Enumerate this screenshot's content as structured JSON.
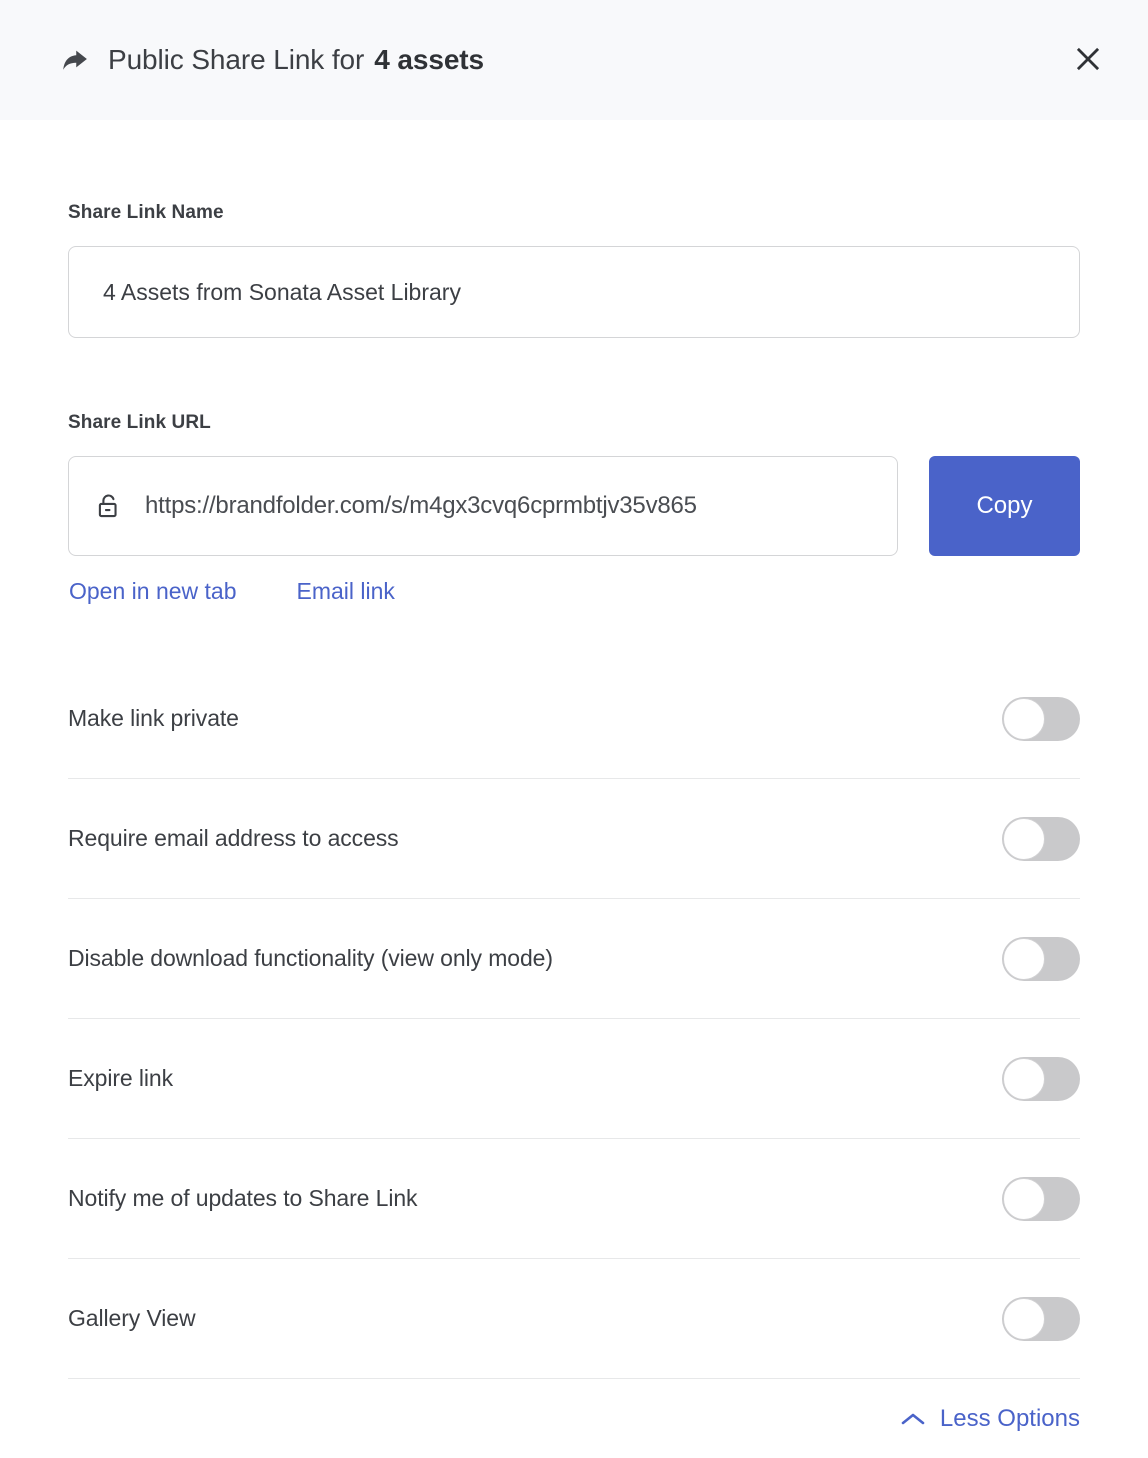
{
  "header": {
    "share_icon": "share-arrow-icon",
    "title_prefix": "Public Share Link for",
    "title_count": "4 assets",
    "close_icon": "close-icon"
  },
  "name_field": {
    "label": "Share Link Name",
    "value": "4 Assets from Sonata Asset Library",
    "placeholder": "Share Link Name"
  },
  "url_field": {
    "label": "Share Link URL",
    "lock_icon": "unlocked-padlock-icon",
    "value": "https://brandfolder.com/s/m4gx3cvq6cprmbtjv35v865",
    "copy_label": "Copy"
  },
  "links": {
    "open_new_tab": "Open in new tab",
    "email_link": "Email link"
  },
  "options": [
    {
      "label": "Make link private",
      "on": false
    },
    {
      "label": "Require email address to access",
      "on": false
    },
    {
      "label": "Disable download functionality (view only mode)",
      "on": false
    },
    {
      "label": "Expire link",
      "on": false
    },
    {
      "label": "Notify me of updates to Share Link",
      "on": false
    },
    {
      "label": "Gallery View",
      "on": false
    }
  ],
  "footer": {
    "less_options_label": "Less Options",
    "chevron_icon": "chevron-up-icon"
  },
  "colors": {
    "accent": "#4a63c9",
    "header_bg": "#f8f9fb",
    "text": "#3c3f44",
    "border": "#d4d5d7",
    "divider": "#e7e8e9",
    "toggle_off": "#c9c9cb"
  }
}
